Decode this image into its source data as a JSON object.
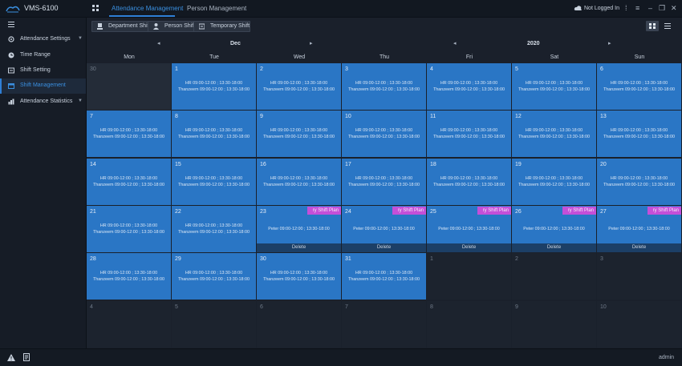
{
  "app": {
    "title": "VMS-6100"
  },
  "header": {
    "tabs": [
      {
        "label": "Attendance Management"
      },
      {
        "label": "Person Management"
      }
    ],
    "login_status": "Not Logged In"
  },
  "sidebar": {
    "items": [
      {
        "label": "Attendance Settings",
        "icon": "settings-icon"
      },
      {
        "label": "Time Range",
        "icon": "clock-icon"
      },
      {
        "label": "Shift Setting",
        "icon": "shift-icon"
      },
      {
        "label": "Shift Management",
        "icon": "calendar-icon"
      },
      {
        "label": "Attendance Statistics",
        "icon": "stats-icon"
      }
    ]
  },
  "toolbar": {
    "department_shift": "Department Shift",
    "person_shift": "Person Shift",
    "temporary_shift": "Temporary Shift"
  },
  "calendar": {
    "month": "Dec",
    "year": "2020",
    "weekdays": [
      "Mon",
      "Tue",
      "Wed",
      "Thu",
      "Fri",
      "Sat",
      "Sun"
    ],
    "dept_line1": "HR 09:00-12:00 ; 13:30-18:00",
    "dept_line2": "Thanzeem 09:00-12:00 ; 13:30-18:00",
    "person_line": "Peter 09:00-12:00 ; 13:30-18:00",
    "tag_label": "ry Shift Plan",
    "delete_label": "Delete",
    "weeks": [
      [
        {
          "d": "30",
          "t": "gray"
        },
        {
          "d": "1",
          "t": "dept"
        },
        {
          "d": "2",
          "t": "dept"
        },
        {
          "d": "3",
          "t": "dept"
        },
        {
          "d": "4",
          "t": "dept"
        },
        {
          "d": "5",
          "t": "dept"
        },
        {
          "d": "6",
          "t": "dept"
        }
      ],
      [
        {
          "d": "7",
          "t": "dept"
        },
        {
          "d": "8",
          "t": "dept"
        },
        {
          "d": "9",
          "t": "dept"
        },
        {
          "d": "10",
          "t": "dept"
        },
        {
          "d": "11",
          "t": "dept"
        },
        {
          "d": "12",
          "t": "dept"
        },
        {
          "d": "13",
          "t": "dept"
        }
      ],
      [
        {
          "d": "14",
          "t": "dept"
        },
        {
          "d": "15",
          "t": "dept"
        },
        {
          "d": "16",
          "t": "dept"
        },
        {
          "d": "17",
          "t": "dept"
        },
        {
          "d": "18",
          "t": "dept"
        },
        {
          "d": "19",
          "t": "dept"
        },
        {
          "d": "20",
          "t": "dept"
        }
      ],
      [
        {
          "d": "21",
          "t": "dept"
        },
        {
          "d": "22",
          "t": "dept"
        },
        {
          "d": "23",
          "t": "temp"
        },
        {
          "d": "24",
          "t": "temp"
        },
        {
          "d": "25",
          "t": "temp"
        },
        {
          "d": "26",
          "t": "temp"
        },
        {
          "d": "27",
          "t": "temp"
        }
      ],
      [
        {
          "d": "28",
          "t": "dept"
        },
        {
          "d": "29",
          "t": "dept"
        },
        {
          "d": "30",
          "t": "dept"
        },
        {
          "d": "31",
          "t": "dept"
        },
        {
          "d": "1",
          "t": "dark"
        },
        {
          "d": "2",
          "t": "dark"
        },
        {
          "d": "3",
          "t": "dark"
        }
      ],
      [
        {
          "d": "4",
          "t": "dark"
        },
        {
          "d": "5",
          "t": "dark"
        },
        {
          "d": "6",
          "t": "dark"
        },
        {
          "d": "7",
          "t": "dark"
        },
        {
          "d": "8",
          "t": "dark"
        },
        {
          "d": "9",
          "t": "dark"
        },
        {
          "d": "10",
          "t": "dark"
        }
      ]
    ]
  },
  "status": {
    "user": "admin"
  },
  "colors": {
    "accent": "#2f7fd6",
    "cell_blue": "#2a76c5",
    "tag_magenta": "#c44fd8"
  }
}
